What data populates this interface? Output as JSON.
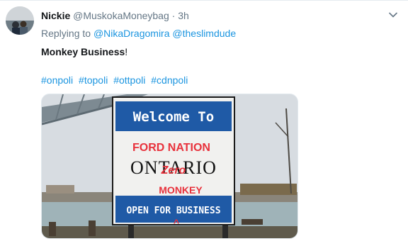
{
  "tweet": {
    "name": "Nickie",
    "handle": "@MuskokaMoneybag",
    "separator": "·",
    "time": "3h",
    "replying_prefix": "Replying to",
    "mentions": [
      "@NikaDragomira",
      "@theslimdude"
    ],
    "text_bold": "Monkey Business",
    "text_rest": "!",
    "hashtags": [
      "#onpoli",
      "#topoli",
      "#ottpoli",
      "#cdnpoli"
    ]
  },
  "image": {
    "sign_top": "Welcome To",
    "graffiti_top": "FORD NATION",
    "province": "ONTARIO",
    "graffiti_scribble": "Zero",
    "graffiti_word": "MONKEY",
    "caret": "^",
    "sign_bottom": "OPEN FOR BUSINESS"
  },
  "icons": {
    "more": "chevron-down-icon"
  },
  "colors": {
    "link": "#1b95e0",
    "muted": "#657786",
    "sign_blue": "#1f5aa6",
    "graffiti_red": "#e8323c"
  }
}
